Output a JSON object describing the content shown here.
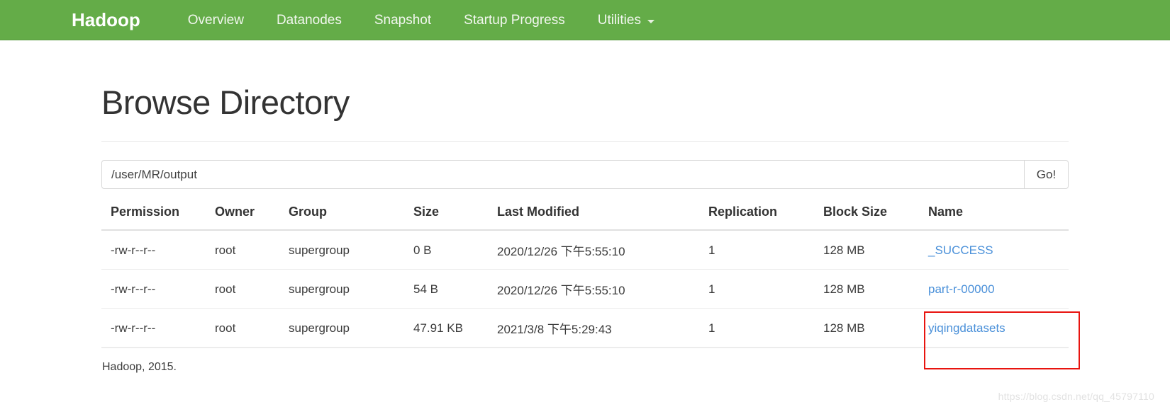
{
  "navbar": {
    "brand": "Hadoop",
    "items": [
      {
        "label": "Overview",
        "has_caret": false
      },
      {
        "label": "Datanodes",
        "has_caret": false
      },
      {
        "label": "Snapshot",
        "has_caret": false
      },
      {
        "label": "Startup Progress",
        "has_caret": false
      },
      {
        "label": "Utilities",
        "has_caret": true
      }
    ],
    "background_color": "#64ac48",
    "caret_icon": "chevron-down-icon"
  },
  "page": {
    "title": "Browse Directory"
  },
  "path_form": {
    "value": "/user/MR/output",
    "placeholder": "Enter a directory path",
    "submit_label": "Go!"
  },
  "table": {
    "headers": [
      "Permission",
      "Owner",
      "Group",
      "Size",
      "Last Modified",
      "Replication",
      "Block Size",
      "Name"
    ],
    "rows": [
      {
        "permission": "-rw-r--r--",
        "owner": "root",
        "group": "supergroup",
        "size": "0 B",
        "last_modified": "2020/12/26 下午5:55:10",
        "replication": "1",
        "block_size": "128 MB",
        "name": "_SUCCESS"
      },
      {
        "permission": "-rw-r--r--",
        "owner": "root",
        "group": "supergroup",
        "size": "54 B",
        "last_modified": "2020/12/26 下午5:55:10",
        "replication": "1",
        "block_size": "128 MB",
        "name": "part-r-00000"
      },
      {
        "permission": "-rw-r--r--",
        "owner": "root",
        "group": "supergroup",
        "size": "47.91 KB",
        "last_modified": "2021/3/8 下午5:29:43",
        "replication": "1",
        "block_size": "128 MB",
        "name": "yiqingdatasets"
      }
    ]
  },
  "annotation": {
    "color": "#e8140f",
    "target": "yiqingdatasets"
  },
  "footer": {
    "text": "Hadoop, 2015.",
    "watermark": "https://blog.csdn.net/qq_45797110"
  },
  "colors": {
    "link": "#4a90d9",
    "nav_green": "#64ac48",
    "annotation_red": "#e8140f"
  }
}
